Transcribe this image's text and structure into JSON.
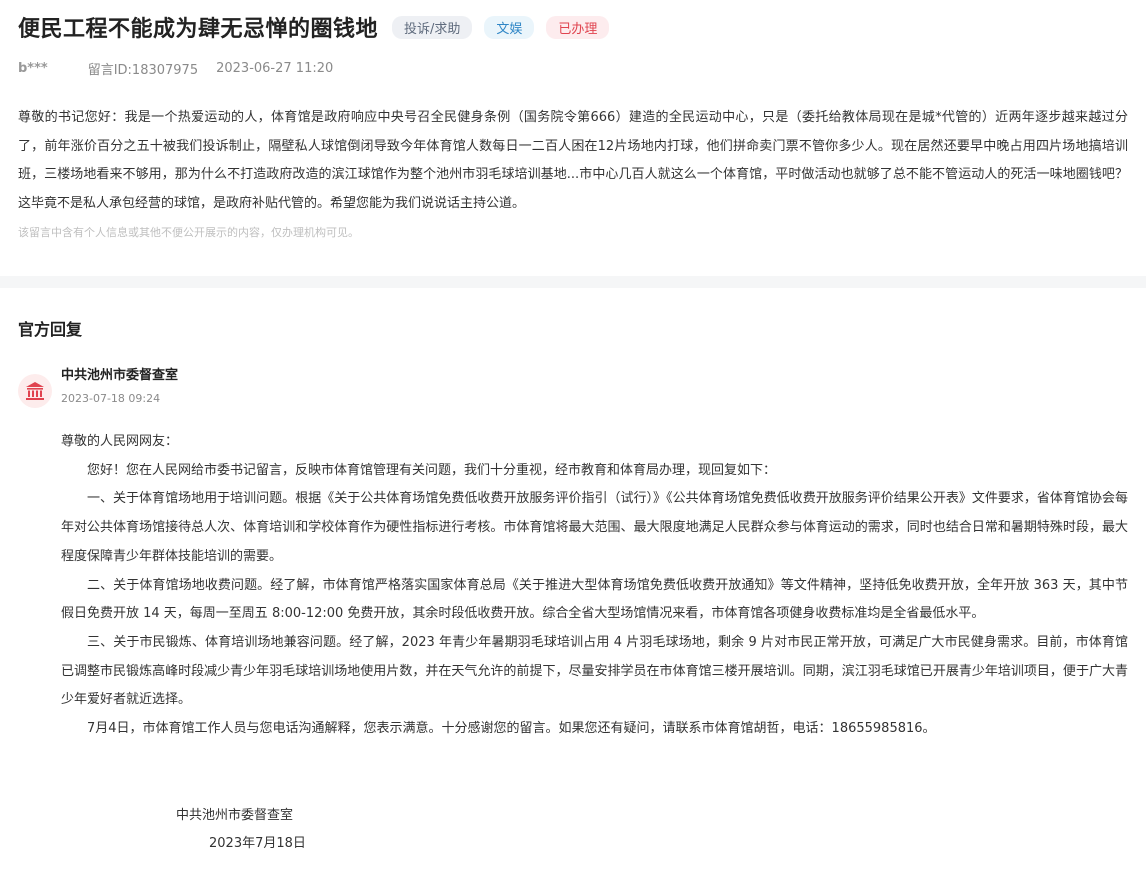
{
  "message": {
    "title": "便民工程不能成为肆无忌惮的圈钱地",
    "tags": {
      "type": "投诉/求助",
      "field": "文娱",
      "status": "已办理"
    },
    "author": "b***",
    "message_id": "留言ID:18307975",
    "datetime": "2023-06-27 11:20",
    "content": "尊敬的书记您好：我是一个热爱运动的人，体育馆是政府响应中央号召全民健身条例（国务院令第666）建造的全民运动中心，只是（委托给教体局现在是城*代管的）近两年逐步越来越过分了，前年涨价百分之五十被我们投诉制止，隔壁私人球馆倒闭导致今年体育馆人数每日一二百人困在12片场地内打球，他们拼命卖门票不管你多少人。现在居然还要早中晚占用四片场地搞培训班，三楼场地看来不够用，那为什么不打造政府改造的滨江球馆作为整个池州市羽毛球培训基地...市中心几百人就这么一个体育馆，平时做活动也就够了总不能不管运动人的死活一味地圈钱吧？这毕竟不是私人承包经营的球馆，是政府补贴代管的。希望您能为我们说说话主持公道。",
    "privacy_note": "该留言中含有个人信息或其他不便公开展示的内容，仅办理机构可见。"
  },
  "official_reply": {
    "section_title": "官方回复",
    "org_name": "中共池州市委督查室",
    "reply_datetime": "2023-07-18 09:24",
    "icon": "government-building-icon",
    "paragraphs": [
      "尊敬的人民网网友：",
      "您好！您在人民网给市委书记留言，反映市体育馆管理有关问题，我们十分重视，经市教育和体育局办理，现回复如下：",
      "一、关于体育馆场地用于培训问题。根据《关于公共体育场馆免费低收费开放服务评价指引（试行）》《公共体育场馆免费低收费开放服务评价结果公开表》文件要求，省体育馆协会每年对公共体育场馆接待总人次、体育培训和学校体育作为硬性指标进行考核。市体育馆将最大范围、最大限度地满足人民群众参与体育运动的需求，同时也结合日常和暑期特殊时段，最大程度保障青少年群体技能培训的需要。",
      "二、关于体育馆场地收费问题。经了解，市体育馆严格落实国家体育总局《关于推进大型体育场馆免费低收费开放通知》等文件精神，坚持低免收费开放，全年开放 363 天，其中节假日免费开放 14 天，每周一至周五 8:00-12:00 免费开放，其余时段低收费开放。综合全省大型场馆情况来看，市体育馆各项健身收费标准均是全省最低水平。",
      "三、关于市民锻炼、体育培训场地兼容问题。经了解，2023 年青少年暑期羽毛球培训占用 4 片羽毛球场地，剩余 9 片对市民正常开放，可满足广大市民健身需求。目前，市体育馆已调整市民锻炼高峰时段减少青少年羽毛球培训场地使用片数，并在天气允许的前提下，尽量安排学员在市体育馆三楼开展培训。同期，滨江羽毛球馆已开展青少年培训项目，便于广大青少年爱好者就近选择。",
      "7月4日，市体育馆工作人员与您电话沟通解释，您表示满意。十分感谢您的留言。如果您还有疑问，请联系市体育馆胡哲，电话：18655985816。"
    ],
    "signature": "中共池州市委督查室",
    "signature_date": "2023年7月18日"
  }
}
